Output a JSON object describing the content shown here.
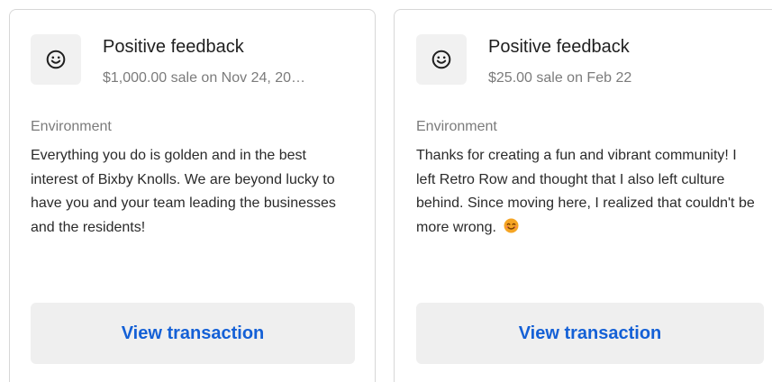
{
  "cards": [
    {
      "title": "Positive feedback",
      "subtitle": "$1,000.00 sale on Nov 24, 20…",
      "category": "Environment",
      "message": "Everything you do is golden and in the best interest of Bixby Knolls. We are beyond lucky to have you and your team leading the businesses and the residents!",
      "button_label": "View transaction",
      "icon": "smiley-face-icon"
    },
    {
      "title": "Positive feedback",
      "subtitle": "$25.00 sale on Feb 22",
      "category": "Environment",
      "message": "Thanks for creating a fun and vibrant community! I left Retro Row and thought that I also left culture behind. Since moving here, I realized that couldn't be more wrong.",
      "button_label": "View transaction",
      "icon": "smiley-face-icon",
      "message_emoji": "smiling-face-emoji"
    }
  ],
  "colors": {
    "card_border": "#d7d7d7",
    "icon_bg": "#f1f1f1",
    "button_bg": "#efefef",
    "button_text": "#1460d6",
    "muted_text": "#7b7b7b",
    "body_text": "#2a2a2a",
    "emoji": "#f5a524"
  }
}
